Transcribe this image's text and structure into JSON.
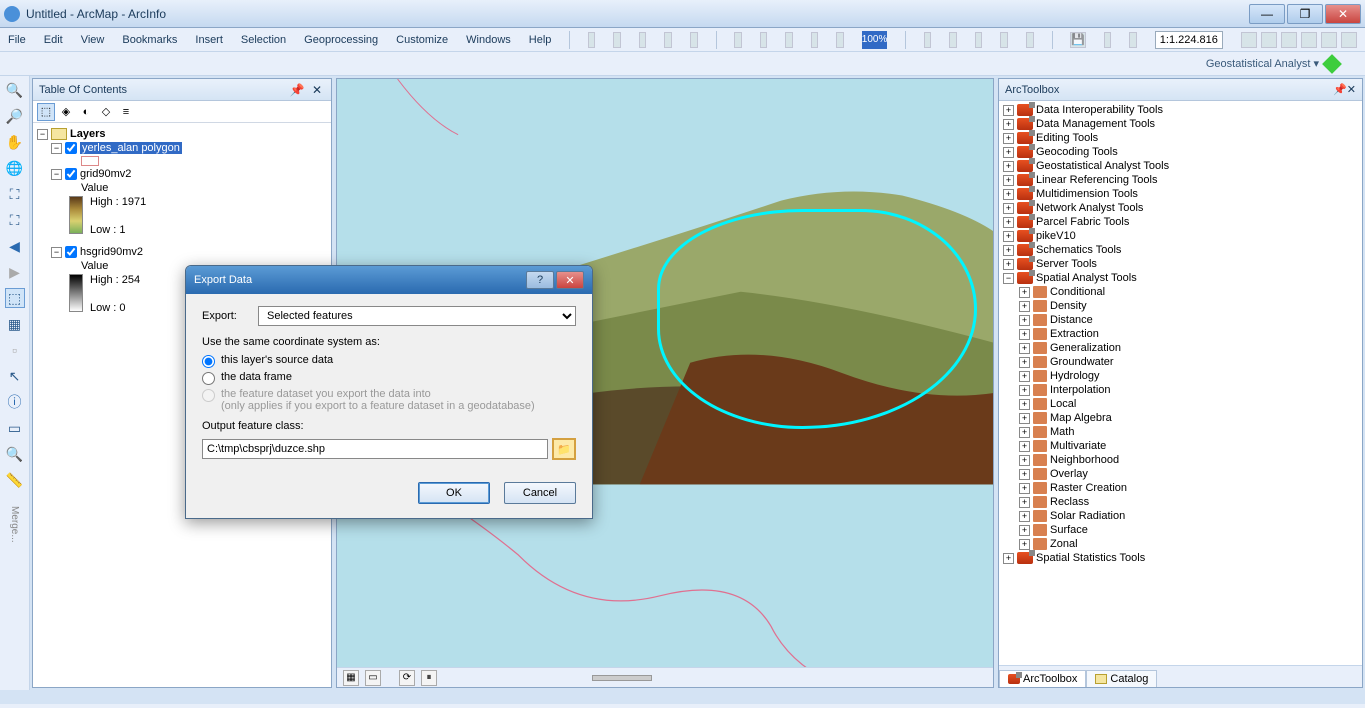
{
  "window": {
    "title": "Untitled - ArcMap - ArcInfo"
  },
  "menu": {
    "items": [
      "File",
      "Edit",
      "View",
      "Bookmarks",
      "Insert",
      "Selection",
      "Geoprocessing",
      "Customize",
      "Windows",
      "Help"
    ],
    "zoom_pct": "100%",
    "scale": "1:1.224.816"
  },
  "toolbar2": {
    "label": "Geostatistical Analyst ▾"
  },
  "toc": {
    "title": "Table Of Contents",
    "root": "Layers",
    "layer1": {
      "name": "yerles_alan polygon"
    },
    "layer2": {
      "name": "grid90mv2",
      "value_label": "Value",
      "high": "High : 1971",
      "low": "Low : 1"
    },
    "layer3": {
      "name": "hsgrid90mv2",
      "value_label": "Value",
      "high": "High : 254",
      "low": "Low : 0"
    }
  },
  "left_tools": {
    "merge": "Merge..."
  },
  "toolbox": {
    "title": "ArcToolbox",
    "items": [
      "Data Interoperability Tools",
      "Data Management Tools",
      "Editing Tools",
      "Geocoding Tools",
      "Geostatistical Analyst Tools",
      "Linear Referencing Tools",
      "Multidimension Tools",
      "Network Analyst Tools",
      "Parcel Fabric Tools",
      "pikeV10",
      "Schematics Tools",
      "Server Tools"
    ],
    "spatial_analyst": {
      "name": "Spatial Analyst Tools",
      "toolsets": [
        "Conditional",
        "Density",
        "Distance",
        "Extraction",
        "Generalization",
        "Groundwater",
        "Hydrology",
        "Interpolation",
        "Local",
        "Map Algebra",
        "Math",
        "Multivariate",
        "Neighborhood",
        "Overlay",
        "Raster Creation",
        "Reclass",
        "Solar Radiation",
        "Surface",
        "Zonal"
      ]
    },
    "last_item": "Spatial Statistics Tools",
    "tabs": {
      "toolbox": "ArcToolbox",
      "catalog": "Catalog"
    }
  },
  "dialog": {
    "title": "Export Data",
    "export_label": "Export:",
    "export_value": "Selected features",
    "coord_label": "Use the same coordinate system as:",
    "radio1": "this layer's source data",
    "radio2": "the data frame",
    "radio3a": "the feature dataset you export the data into",
    "radio3b": "(only applies if you export to a feature dataset in a geodatabase)",
    "output_label": "Output feature class:",
    "output_value": "C:\\tmp\\cbsprj\\duzce.shp",
    "ok": "OK",
    "cancel": "Cancel"
  }
}
